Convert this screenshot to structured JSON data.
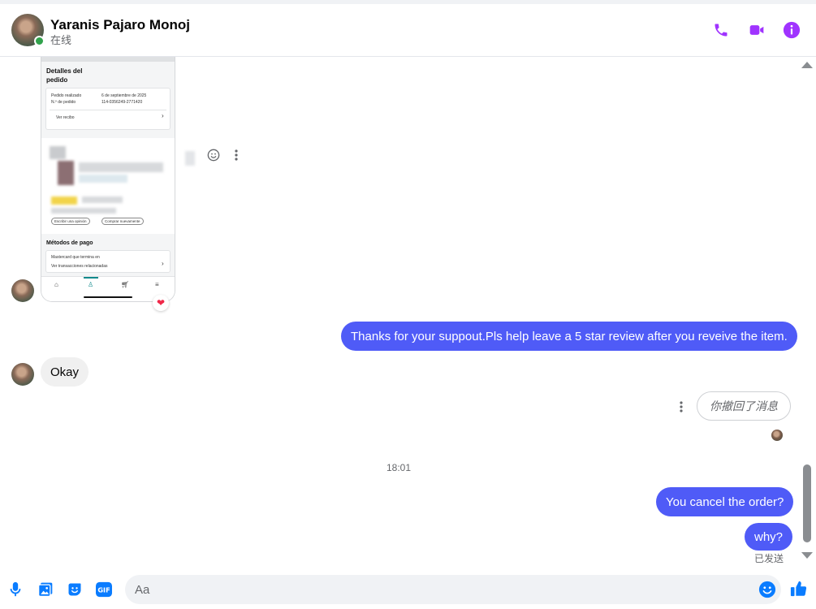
{
  "colors": {
    "accent": "#a033ff",
    "bubble_out": "#4f5bf7",
    "online": "#31a24c",
    "composer_blue": "#0a7cff"
  },
  "header": {
    "name": "Yaranis Pajaro Monoj",
    "status": "在线",
    "icons": [
      "phone-icon",
      "video-call-icon",
      "info-icon"
    ]
  },
  "screenshot": {
    "title": "Detalles del pedido",
    "order_placed_label": "Pedido realizado",
    "order_placed_value": "6 de septiembre de 2025",
    "order_number_label": "N.º de pedido",
    "order_number_value": "114-0356249-2771420",
    "view_receipt": "Ver recibo",
    "write_review": "Escribir una opinión",
    "buy_again": "Comprar nuevamente",
    "payment_title": "Métodos de pago",
    "card_line": "Mastercard que termina en",
    "transactions": "Ver transacciones relacionadas"
  },
  "messages": {
    "m1": "Thanks for your suppout.Pls help leave a 5 star review after you reveive the item.",
    "m2": "Okay",
    "m3_retracted": "你撤回了消息",
    "timestamp": "18:01",
    "m4": "You cancel the order?",
    "m5": "why?",
    "sent_status": "已发送"
  },
  "composer": {
    "placeholder": "Aa",
    "icons": [
      "microphone-icon",
      "image-icon",
      "sticker-icon",
      "gif-icon",
      "emoji-icon",
      "thumbs-up-icon"
    ]
  }
}
